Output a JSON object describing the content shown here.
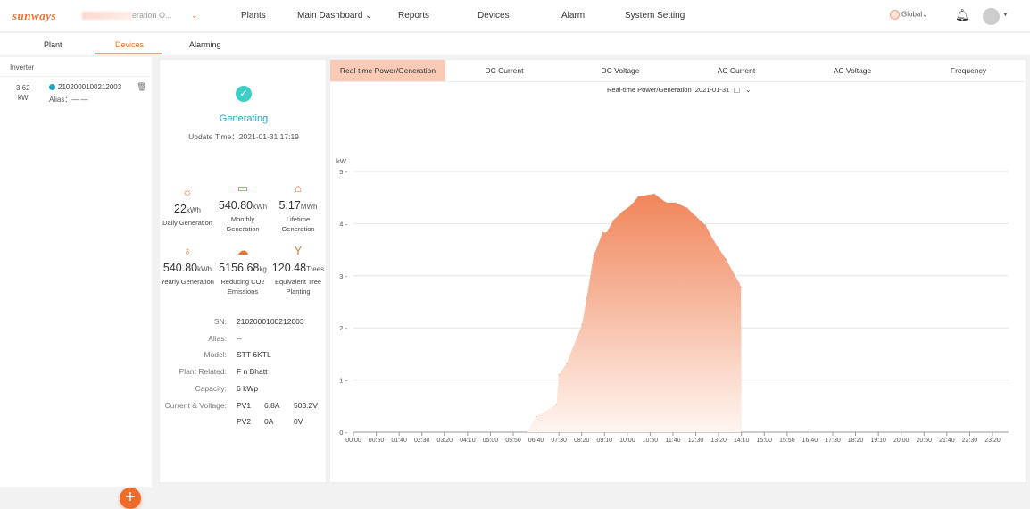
{
  "header": {
    "logo": "sunways",
    "plant_selector": "eration O...",
    "nav": [
      "Plants",
      "Main Dashboard ⌄",
      "Reports",
      "Devices",
      "Alarm",
      "System Setting"
    ],
    "language": "Global",
    "language_caret": "⌄"
  },
  "subtabs": [
    "Plant",
    "Devices",
    "Alarming"
  ],
  "device_list": {
    "header": "Inverter",
    "items": [
      {
        "power": "3.62",
        "unit": "kW",
        "sn": "2102000100212003",
        "alias": "Alias：— —"
      }
    ]
  },
  "device_detail": {
    "status": "Generating",
    "update_time": "Update Time：2021-01-31 17:19",
    "stats": [
      {
        "icon": "sun-icon",
        "value": "22",
        "unit": "kWh",
        "label": "Daily Generation"
      },
      {
        "icon": "battery-icon",
        "value": "540.80",
        "unit": "kWh",
        "label": "Monthly Generation"
      },
      {
        "icon": "house-leaf-icon",
        "value": "5.17",
        "unit": "MWh",
        "label": "Lifetime Generation"
      },
      {
        "icon": "plug-leaf-icon",
        "value": "540.80",
        "unit": "kWh",
        "label": "Yearly Generation"
      },
      {
        "icon": "cloud-co2-icon",
        "value": "5156.68",
        "unit": "kg",
        "label": "Reducing CO2 Emissions"
      },
      {
        "icon": "tree-icon",
        "value": "120.48",
        "unit": "Trees",
        "label": "Equivalent Tree Planting"
      }
    ],
    "info": [
      {
        "label": "SN:",
        "value": "2102000100212003"
      },
      {
        "label": "Alias:",
        "value": "--"
      },
      {
        "label": "Model:",
        "value": "STT-6KTL"
      },
      {
        "label": "Plant Related:",
        "value": "F      n Bhatt"
      },
      {
        "label": "Capacity:",
        "value": "6  kWp"
      },
      {
        "label": "Current & Voltage:",
        "value": ""
      }
    ],
    "pv": [
      {
        "name": "PV1",
        "current": "6.8A",
        "voltage": "503.2V"
      },
      {
        "name": "PV2",
        "current": "0A",
        "voltage": "0V"
      }
    ]
  },
  "chart_tabs": [
    "Real-time Power/Generation",
    "DC Current",
    "DC Voltage",
    "AC Current",
    "AC Voltage",
    "Frequency"
  ],
  "chart_header": {
    "label": "Real-time Power/Generation",
    "date": "2021-01-31"
  },
  "colors": {
    "accent": "#e8742f",
    "area_top": "#f0855a",
    "status": "#1fa6c6"
  },
  "chart_data": {
    "type": "area",
    "ylabel": "kW",
    "ylim": [
      0,
      5
    ],
    "yticks": [
      0,
      1,
      2,
      3,
      4,
      5
    ],
    "xticks": [
      "00:00",
      "00:50",
      "01:40",
      "02:30",
      "03:20",
      "04:10",
      "05:00",
      "05:50",
      "06:40",
      "07:30",
      "08:20",
      "09:10",
      "10:00",
      "10:50",
      "11:40",
      "12:30",
      "13:20",
      "14:10",
      "15:00",
      "15:50",
      "16:40",
      "17:30",
      "18:20",
      "19:10",
      "20:00",
      "20:50",
      "21:40",
      "22:30",
      "23:20"
    ],
    "grid": true,
    "x": [
      "06:20",
      "06:40",
      "07:25",
      "07:30",
      "07:47",
      "08:21",
      "08:31",
      "08:46",
      "09:06",
      "09:15",
      "09:29",
      "09:49",
      "10:08",
      "10:24",
      "10:59",
      "11:26",
      "11:46",
      "12:11",
      "12:31",
      "12:51",
      "13:10",
      "13:36",
      "14:05",
      "14:09",
      "14:10"
    ],
    "values": [
      0,
      0.3,
      0.53,
      1.1,
      1.32,
      2.07,
      2.58,
      3.38,
      3.83,
      3.83,
      4.06,
      4.23,
      4.35,
      4.52,
      4.57,
      4.4,
      4.4,
      4.3,
      4.13,
      3.97,
      3.66,
      3.32,
      2.86,
      2.78,
      0
    ]
  }
}
